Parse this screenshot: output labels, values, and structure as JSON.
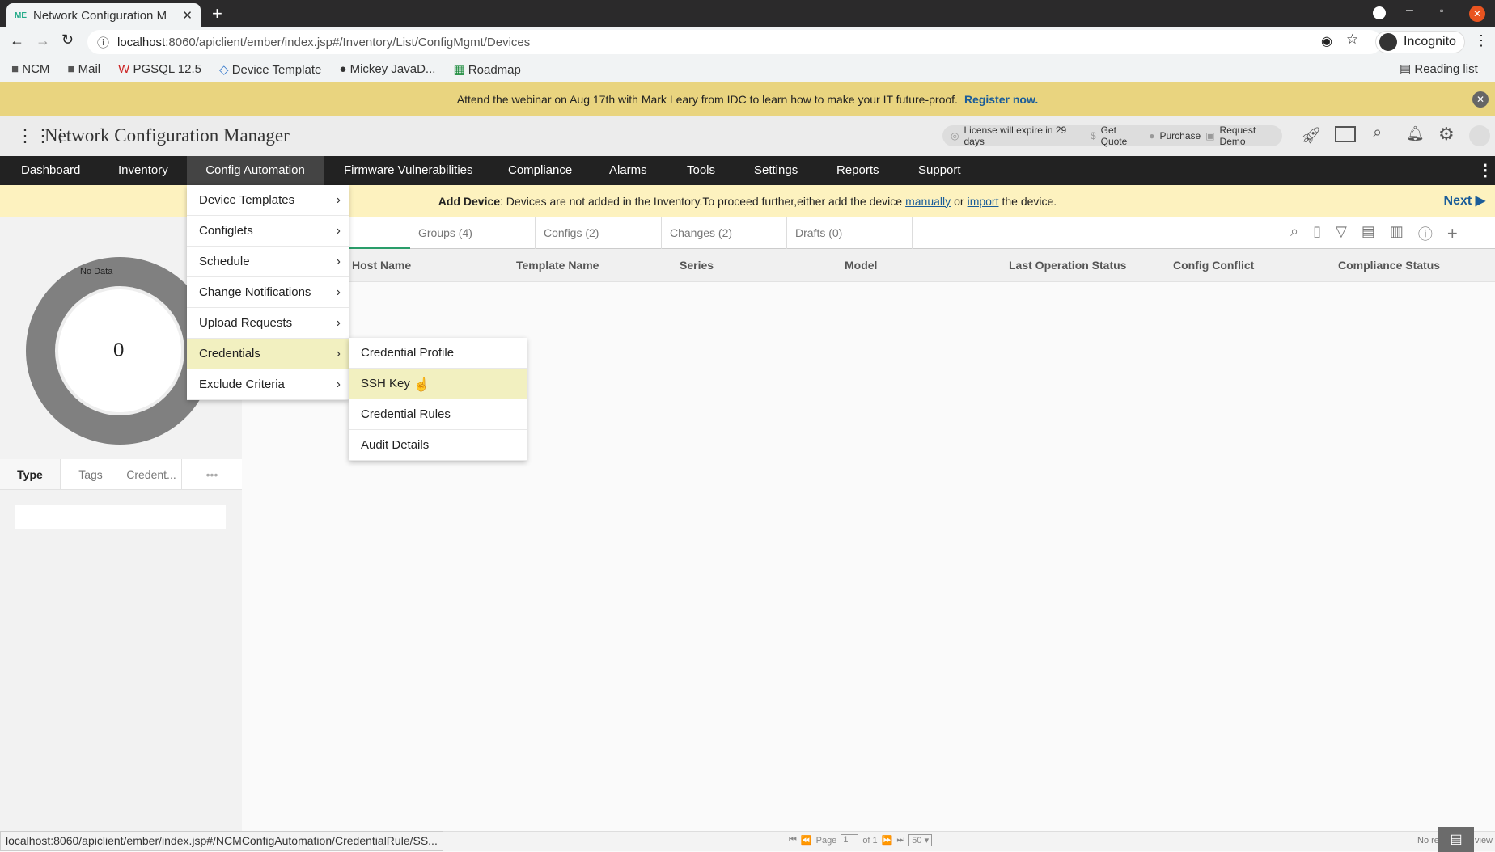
{
  "browser": {
    "tab_title": "Network Configuration M",
    "url_host": "localhost",
    "url_rest": ":8060/apiclient/ember/index.jsp#/Inventory/List/ConfigMgmt/Devices",
    "profile": "Incognito",
    "reading_list": "Reading list",
    "bookmarks": [
      {
        "label": "NCM",
        "icon": "folder-icon"
      },
      {
        "label": "Mail",
        "icon": "folder-icon"
      },
      {
        "label": "PGSQL 12.5",
        "icon": "pgsql-icon"
      },
      {
        "label": "Device Template",
        "icon": "diamond-icon"
      },
      {
        "label": "Mickey JavaD...",
        "icon": "globe-icon"
      },
      {
        "label": "Roadmap",
        "icon": "sheet-icon"
      }
    ]
  },
  "promo": {
    "text": "Attend the webinar on Aug 17th with Mark Leary from IDC to learn how to make your IT future-proof.",
    "link": "Register now."
  },
  "app": {
    "title": "Network Configuration Manager",
    "license": "License will expire in 29 days",
    "get_quote": "Get Quote",
    "purchase": "Purchase",
    "request_demo": "Request Demo"
  },
  "nav": [
    "Dashboard",
    "Inventory",
    "Config Automation",
    "Firmware Vulnerabilities",
    "Compliance",
    "Alarms",
    "Tools",
    "Settings",
    "Reports",
    "Support"
  ],
  "add_device": {
    "label": "Add Device",
    "text": ": Devices are not added in the Inventory.To proceed further,either add the device",
    "link1": "manually",
    "or": "or",
    "link2": "import",
    "tail": "the device.",
    "next": "Next"
  },
  "tabs": [
    "Groups (4)",
    "Configs (2)",
    "Changes (2)",
    "Drafts (0)"
  ],
  "columns": [
    "Host Name",
    "Template Name",
    "Series",
    "Model",
    "Last Operation Status",
    "Config Conflict",
    "Compliance Status"
  ],
  "left": {
    "no_data": "No Data",
    "count": "0",
    "tabs": [
      "Type",
      "Tags",
      "Credent...",
      "•••"
    ]
  },
  "menu": [
    "Device Templates",
    "Configlets",
    "Schedule",
    "Change Notifications",
    "Upload Requests",
    "Credentials",
    "Exclude Criteria"
  ],
  "submenu": [
    "Credential Profile",
    "SSH Key",
    "Credential Rules",
    "Audit Details"
  ],
  "pager": {
    "page": "Page",
    "page_value": "1",
    "of": "of 1",
    "per_page": "50",
    "no_records": "No re",
    "view": "view"
  },
  "status_url": "localhost:8060/apiclient/ember/index.jsp#/NCMConfigAutomation/CredentialRule/SS..."
}
